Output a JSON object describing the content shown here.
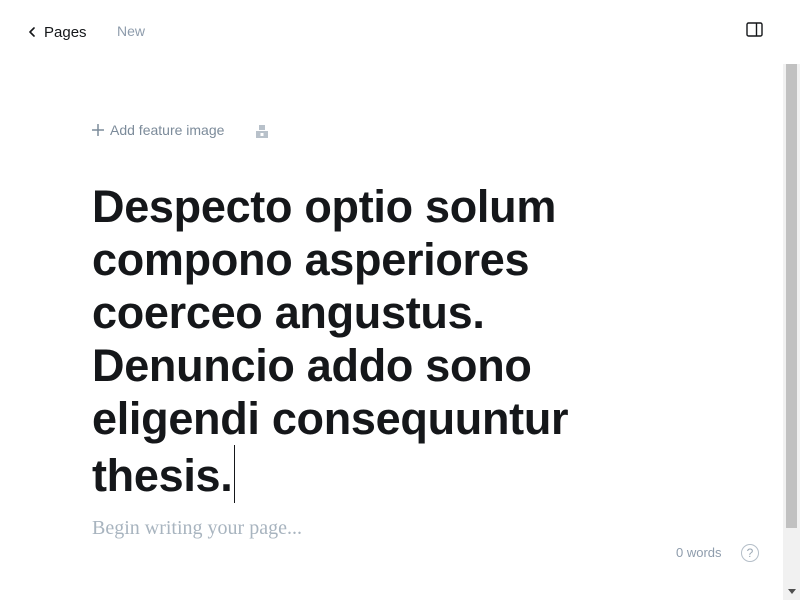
{
  "header": {
    "back_label": "Pages",
    "status": "New"
  },
  "toolbar": {
    "feature_image_label": "Add feature image"
  },
  "post": {
    "title_lines": [
      "Despecto optio solum",
      "compono asperiores",
      "coerceo angustus.",
      "Denuncio addo sono",
      "eligendi consequuntur",
      "thesis."
    ],
    "body_placeholder": "Begin writing your page..."
  },
  "footer": {
    "word_count": "0 words",
    "help_label": "?"
  },
  "icons": {
    "back": "chevron-left-icon",
    "panel": "sidebar-toggle-icon",
    "plus": "plus-icon",
    "snippet": "snippet-icon",
    "help": "help-icon"
  },
  "colors": {
    "text": "#15171a",
    "muted": "#8e9cac",
    "placeholder": "#a8b4bf"
  }
}
